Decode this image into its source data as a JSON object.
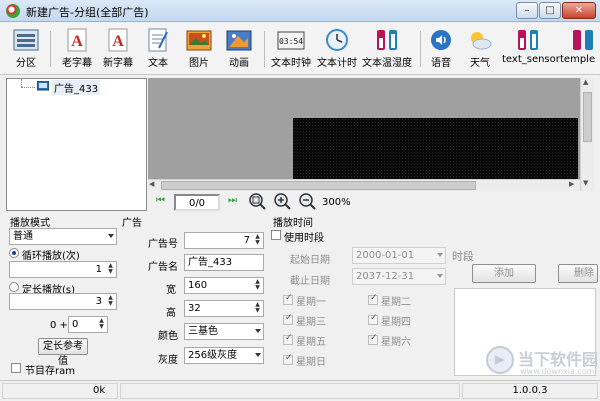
{
  "window": {
    "title": "新建广告-分组(全部广告)"
  },
  "toolbar": {
    "items": [
      {
        "label": "分区",
        "icon": "partition-icon"
      },
      {
        "label": "老字幕",
        "icon": "old-subtitle-icon"
      },
      {
        "label": "新字幕",
        "icon": "new-subtitle-icon"
      },
      {
        "label": "文本",
        "icon": "text-icon"
      },
      {
        "label": "图片",
        "icon": "picture-icon"
      },
      {
        "label": "动画",
        "icon": "animation-icon"
      },
      {
        "label": "文本时钟",
        "icon": "text-clock-icon"
      },
      {
        "label": "文本计时",
        "icon": "text-timer-icon"
      },
      {
        "label": "文本温湿度",
        "icon": "text-temp-humidity-icon"
      },
      {
        "label": "语音",
        "icon": "voice-icon"
      },
      {
        "label": "天气",
        "icon": "weather-icon"
      },
      {
        "label": "text_sensor",
        "icon": "text-sensor-icon"
      },
      {
        "label": "temple",
        "icon": "template-icon"
      }
    ],
    "clock_text": "03:54"
  },
  "tree": {
    "node": "广告_433"
  },
  "preview_nav": {
    "page": "0/0",
    "zoom": "300%"
  },
  "play_mode": {
    "title": "播放模式",
    "mode": "普通",
    "loop_label": "循环播放(次)",
    "loop_count": "1",
    "fixed_label": "定长播放(s)",
    "fixed_value": "3",
    "offset_prefix": "0 +",
    "offset_value": "0",
    "ref_button": "定长参考值",
    "save_ram": "节目存ram"
  },
  "ad": {
    "title": "广告",
    "num_label": "广告号",
    "num_value": "7",
    "name_label": "广告名",
    "name_value": "广告_433",
    "width_label": "宽",
    "width_value": "160",
    "height_label": "高",
    "height_value": "32",
    "color_label": "颜色",
    "color_value": "三基色",
    "gray_label": "灰度",
    "gray_value": "256级灰度"
  },
  "schedule": {
    "title": "播放时间",
    "use_period": "使用时段",
    "start_label": "起始日期",
    "start_value": "2000-01-01",
    "end_label": "截止日期",
    "end_value": "2037-12-31",
    "period_label": "时段",
    "add_button": "添加",
    "delete_button": "删除",
    "days": [
      "星期一",
      "星期二",
      "星期三",
      "星期四",
      "星期五",
      "星期六",
      "星期日"
    ]
  },
  "status": {
    "left": "0k",
    "version": "1.0.0.3"
  },
  "watermark": {
    "text": "当下软件园",
    "sub": "www.downxia.com"
  }
}
